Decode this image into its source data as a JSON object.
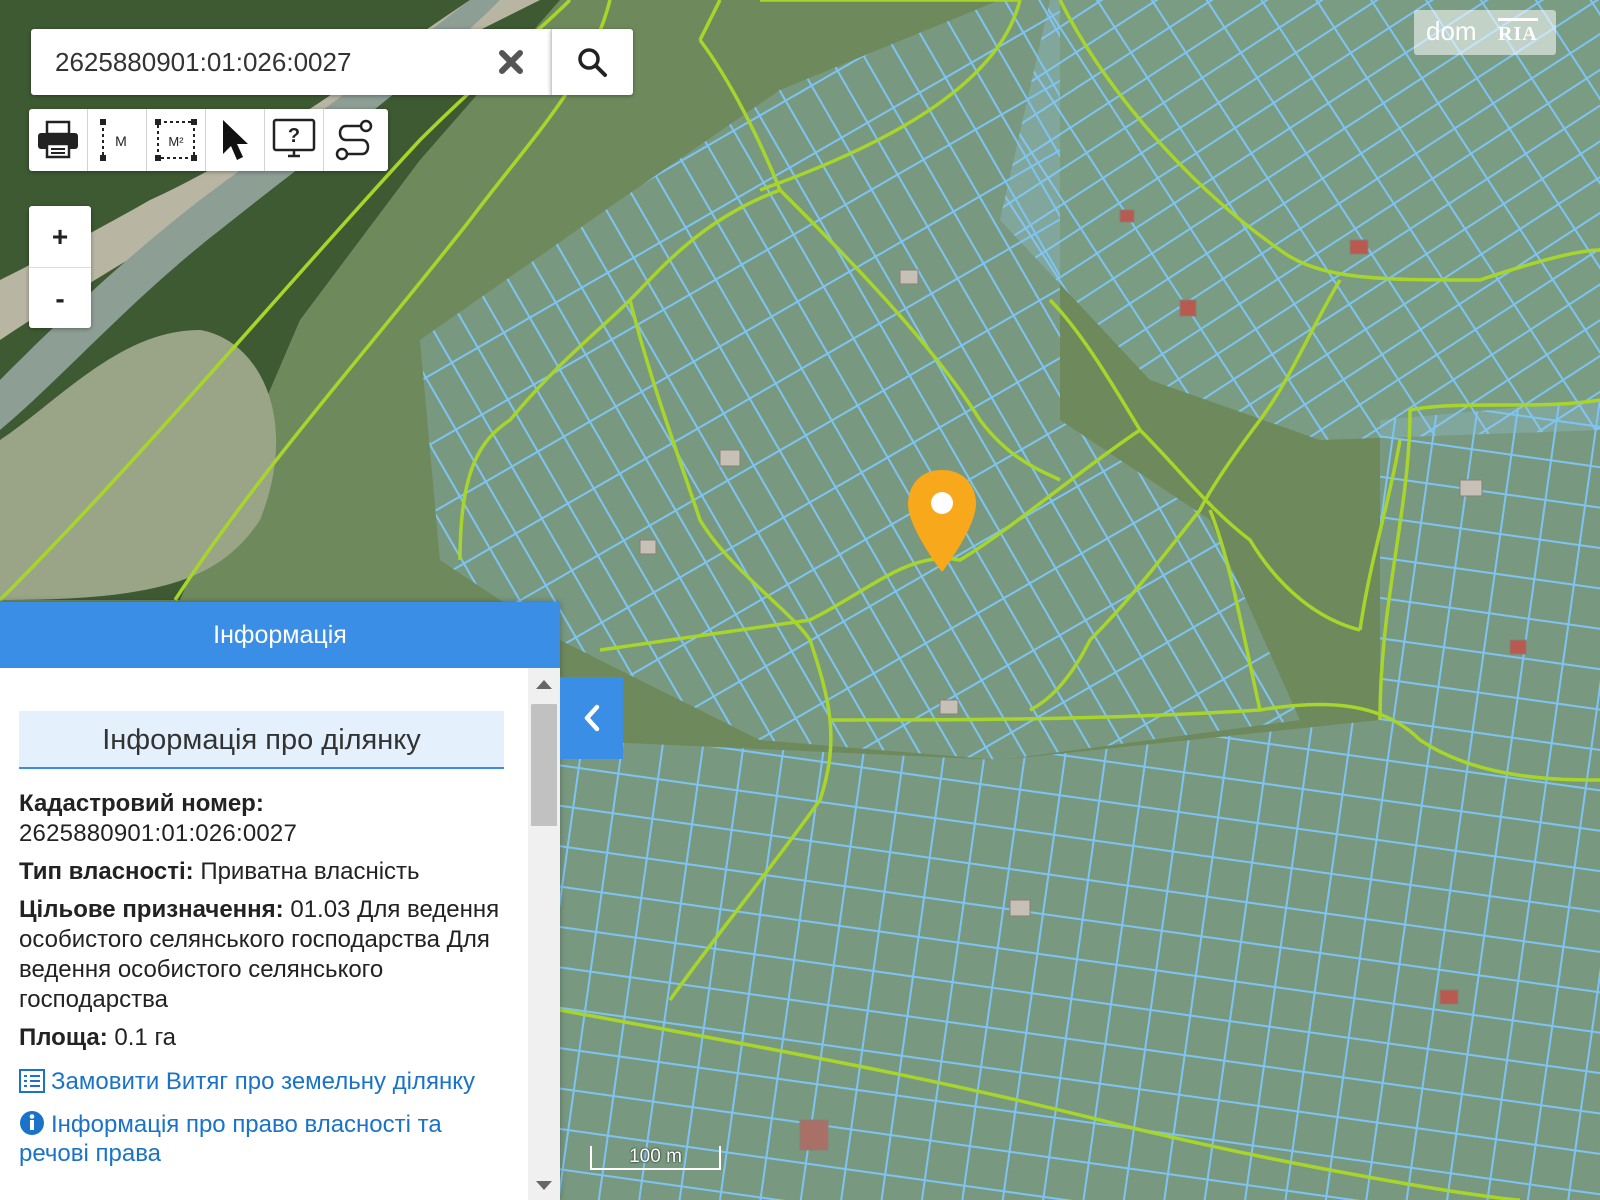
{
  "map": {
    "marker_color": "#f7a81b",
    "boundary_color": "#a8d52b",
    "parcel_color": "#7ec4f2",
    "scale_label": "100 m"
  },
  "search": {
    "value": "2625880901:01:026:0027",
    "clear_icon": "close-icon",
    "search_icon": "search-icon"
  },
  "toolbar": {
    "tools": [
      "printer-icon",
      "measure-distance-icon",
      "measure-area-icon",
      "pointer-icon",
      "info-screen-icon",
      "route-icon"
    ],
    "measure_distance_label": "M",
    "measure_area_label": "M²"
  },
  "zoom": {
    "in_label": "+",
    "out_label": "-"
  },
  "logo": {
    "dom": "dom",
    "ria": "RIA"
  },
  "panel": {
    "header": "Інформація",
    "section_title": "Інформація про ділянку",
    "cadastral_label": "Кадастровий номер:",
    "cadastral_value": "2625880901:01:026:0027",
    "ownership_label": "Тип власності:",
    "ownership_value": "Приватна власність",
    "purpose_label": "Цільове призначення:",
    "purpose_value": "01.03 Для ведення особистого селянського господарства Для ведення особистого селянського господарства",
    "area_label": "Площа:",
    "area_value": "0.1 га",
    "extract_link": "Замовити Витяг про земельну ділянку",
    "rights_link": "Інформація про право власності та речові права"
  }
}
